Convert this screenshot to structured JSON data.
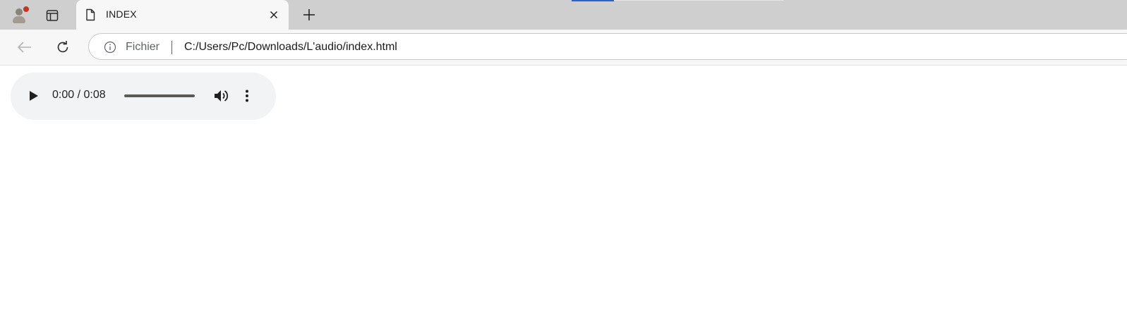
{
  "tab_strip": {
    "profile_icon": "profile-avatar-icon",
    "tab_actions_icon": "tab-actions-icon",
    "active_tab": {
      "title": "INDEX",
      "favicon": "document-icon",
      "close_icon": "close-icon"
    },
    "new_tab_icon": "plus-icon"
  },
  "toolbar": {
    "back_icon": "arrow-left-icon",
    "reload_icon": "reload-icon",
    "omnibox": {
      "info_icon": "info-icon",
      "scheme_label": "Fichier",
      "url": "C:/Users/Pc/Downloads/L'audio/index.html"
    }
  },
  "page": {
    "audio_player": {
      "time_display": "0:00 / 0:08",
      "playback_progress": 0,
      "play_icon": "play-icon",
      "volume_icon": "volume-icon",
      "more_icon": "more-vertical-icon"
    }
  },
  "colors": {
    "tab_strip_bg": "#cfcfcf",
    "toolbar_bg": "#f7f7f7",
    "player_bg": "#f1f3f4",
    "notification_dot": "#c8361e"
  }
}
